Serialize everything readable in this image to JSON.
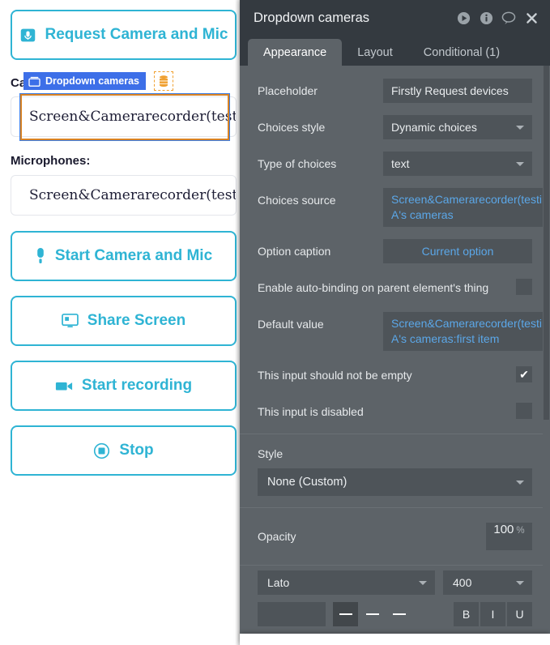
{
  "canvas": {
    "request_button": {
      "label": "Request Camera and Mic",
      "icon": "camera-mic-icon"
    },
    "cameras_label": "Ca",
    "cameras_input_value": "Screen&Camerarecorder(testin",
    "microphones_label": "Microphones:",
    "microphones_input_value": "Screen&Camerarecorder(testin",
    "start_camera_button": {
      "label": "Start Camera and Mic",
      "icon": "microphone-icon"
    },
    "share_screen_button": {
      "label": "Share Screen",
      "icon": "monitor-icon"
    },
    "start_recording_button": {
      "label": "Start recording",
      "icon": "video-camera-icon"
    },
    "stop_button": {
      "label": "Stop",
      "icon": "stop-record-icon"
    },
    "element_badge": {
      "label": "Dropdown cameras",
      "icon": "dropdown-element-icon"
    },
    "data_chip": {
      "icon": "database-icon"
    },
    "accent_color": "#2fb4d4",
    "badge_color": "#3d6fe8",
    "selection_color": "#d98324"
  },
  "panel": {
    "title": "Dropdown cameras",
    "header_icons": [
      {
        "name": "preview-play-icon",
        "glyph": "play"
      },
      {
        "name": "info-icon",
        "glyph": "info"
      },
      {
        "name": "comment-icon",
        "glyph": "comment"
      },
      {
        "name": "close-icon",
        "glyph": "close"
      }
    ],
    "tabs": [
      {
        "label": "Appearance",
        "active": true
      },
      {
        "label": "Layout",
        "active": false
      },
      {
        "label": "Conditional (1)",
        "active": false
      }
    ],
    "appearance": {
      "placeholder": {
        "label": "Placeholder",
        "value": "Firstly Request devices"
      },
      "choices_style": {
        "label": "Choices style",
        "value": "Dynamic choices"
      },
      "type_of_choices": {
        "label": "Type of choices",
        "value": "text"
      },
      "choices_source": {
        "label": "Choices source",
        "value": "Screen&Camerarecorder(testing) A's cameras"
      },
      "option_caption": {
        "label": "Option caption",
        "value": "Current option"
      },
      "auto_binding": {
        "label": "Enable auto-binding on parent element's thing",
        "checked": false
      },
      "default_value": {
        "label": "Default value",
        "value": "Screen&Camerarecorder(testing) A's cameras:first item"
      },
      "not_empty": {
        "label": "This input should not be empty",
        "checked": true,
        "check_glyph": "✔"
      },
      "disabled": {
        "label": "This input is disabled",
        "checked": false
      }
    },
    "style": {
      "label": "Style",
      "value": "None (Custom)"
    },
    "opacity": {
      "label": "Opacity",
      "value": "100",
      "unit": "%"
    },
    "font": {
      "family": "Lato",
      "weight": "400"
    }
  }
}
